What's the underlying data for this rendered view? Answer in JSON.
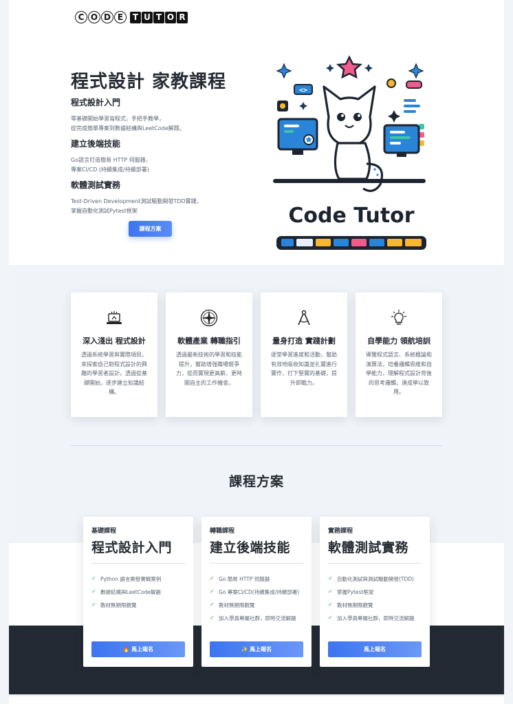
{
  "brand": {
    "logo_code": [
      "C",
      "O",
      "D",
      "E"
    ],
    "logo_tutor": [
      "T",
      "U",
      "T",
      "O",
      "R"
    ],
    "illustration_text": "Code Tutor"
  },
  "hero": {
    "title": "程式設計 家教課程",
    "sections": [
      {
        "heading": "程式設計入門",
        "text": "零基礎開始學習寫程式，手把手教學，\n從完成簡單專案到數據結構與LeetCode解題。"
      },
      {
        "heading": "建立後端技能",
        "text": "Go語言打造簡易 HTTP 伺服器，\n專案CI/CD (持續集成/持續部署)"
      },
      {
        "heading": "軟體測試實務",
        "text": "Test-Driven Development測試驅動開發TDD實踐，\n掌握自動化測試Pytest框架"
      }
    ],
    "cta": "課程方案"
  },
  "features": [
    {
      "icon": "laptop-icon",
      "title": "深入淺出 程式設計",
      "text": "透過系統學習與實際項目，來探索自己對程式設計的興趣的學習者設計。透過從基礎開始，逐步建立知識結構。"
    },
    {
      "icon": "compass-icon",
      "title": "軟體產業 轉職指引",
      "text": "透過最新技術的學習和技能提升，幫助增強職場競爭力，從而實現更高薪、更時間自主的工作機會。"
    },
    {
      "icon": "drafting-compass-icon",
      "title": "量身打造 實踐計劃",
      "text": "逐堂學習進度和活動，幫助有效地吸收知識並扎實進行實作，打下堅實的基礎，提升即戰力。"
    },
    {
      "icon": "lightbulb-icon",
      "title": "自學能力 領航培訓",
      "text": "導覽程式語言、系統概論和演算法，培養邏輯思維和自學能力，理解程式設計背後的思考邏輯，達成學以致用。"
    }
  ],
  "plans_title": "課程方案",
  "plans": [
    {
      "tier": "基礎課程",
      "name": "程式設計入門",
      "items": [
        "Python 語言開發實戰案例",
        "數據結構與LeetCode解題",
        "教材無期限觀覽"
      ],
      "button": "🔥 馬上報名"
    },
    {
      "tier": "轉職課程",
      "name": "建立後端技能",
      "items": [
        "Go 簡易 HTTP 伺服器",
        "Go 專案CI/CD(持續集成/持續部署)",
        "教材無期限觀覽",
        "加入學員專屬社群，即時交流解題"
      ],
      "button": "✨ 馬上報名"
    },
    {
      "tier": "實務課程",
      "name": "軟體測試實務",
      "items": [
        "自動化測試與測試驅動開發(TDD)",
        "掌握Pytest框架",
        "教材無期限觀覽",
        "加入學員專屬社群，即時交流解題"
      ],
      "button": "馬上報名"
    }
  ],
  "colors": {
    "primary": "#3d74f0",
    "dark": "#232a33",
    "check": "#2f9e5b"
  }
}
